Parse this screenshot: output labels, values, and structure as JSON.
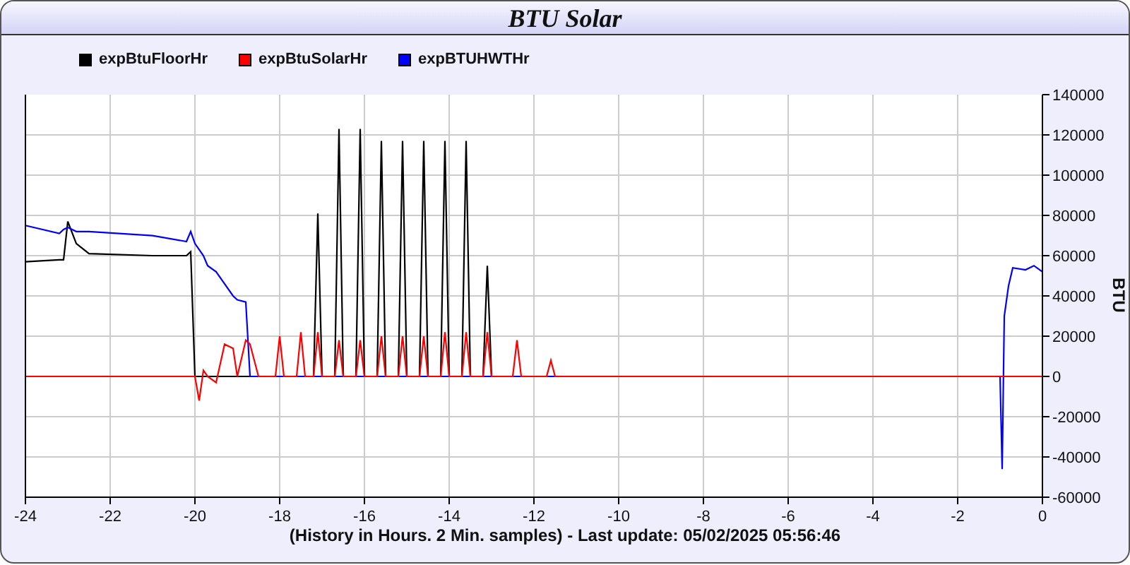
{
  "chart": {
    "chart_data": {
      "type": "line",
      "grid": true,
      "title": "BTU Solar",
      "xlabel": "(History in Hours. 2 Min. samples) - Last update: 05/02/2025 05:56:46",
      "ylabel": "BTU",
      "xlim": [
        -24,
        0
      ],
      "ylim": [
        -60000,
        140000
      ],
      "xticks": [
        -24,
        -22,
        -20,
        -18,
        -16,
        -14,
        -12,
        -10,
        -8,
        -6,
        -4,
        -2,
        0
      ],
      "yticks": [
        -60000,
        -40000,
        -20000,
        0,
        20000,
        40000,
        60000,
        80000,
        100000,
        120000,
        140000
      ],
      "x": [
        -24,
        -23.2,
        -23.1,
        -23,
        -22.8,
        -22.5,
        -21,
        -20.2,
        -20.1,
        -20,
        -19.9,
        -19.8,
        -19.7,
        -19.5,
        -19.3,
        -19.1,
        -19.0,
        -18.8,
        -18.7,
        -18.5,
        -18.1,
        -18.0,
        -17.9,
        -17.6,
        -17.5,
        -17.4,
        -17.2,
        -17.1,
        -17.0,
        -16.7,
        -16.6,
        -16.5,
        -16.2,
        -16.1,
        -16.0,
        -15.7,
        -15.6,
        -15.5,
        -15.2,
        -15.1,
        -15.0,
        -14.7,
        -14.6,
        -14.5,
        -14.2,
        -14.1,
        -14.0,
        -13.7,
        -13.6,
        -13.5,
        -13.2,
        -13.1,
        -13.0,
        -12.5,
        -12.4,
        -12.3,
        -11.7,
        -11.6,
        -11.5,
        -1.0,
        -0.95,
        -0.9,
        -0.8,
        -0.7,
        -0.4,
        -0.2,
        0
      ],
      "series": [
        {
          "name": "expBtuFloorHr",
          "color": "#000000",
          "values": [
            57000,
            58000,
            58000,
            77000,
            66000,
            61000,
            60000,
            60000,
            62000,
            0,
            0,
            0,
            0,
            0,
            0,
            0,
            0,
            0,
            0,
            0,
            0,
            0,
            0,
            0,
            0,
            0,
            0,
            81000,
            0,
            0,
            123000,
            0,
            0,
            123000,
            0,
            0,
            117000,
            0,
            0,
            117000,
            0,
            0,
            117000,
            0,
            0,
            117000,
            0,
            0,
            117000,
            0,
            0,
            55000,
            0,
            0,
            0,
            0,
            0,
            0,
            0,
            0,
            0,
            0,
            0,
            0,
            0,
            0,
            0
          ]
        },
        {
          "name": "expBtuSolarHr",
          "color": "#ff0000",
          "values": [
            0,
            0,
            0,
            0,
            0,
            0,
            0,
            0,
            0,
            0,
            -12000,
            3000,
            0,
            -3000,
            16000,
            14000,
            0,
            18000,
            16000,
            0,
            0,
            20000,
            0,
            0,
            22000,
            0,
            0,
            22000,
            0,
            0,
            18000,
            0,
            0,
            18000,
            0,
            0,
            20000,
            0,
            0,
            20000,
            0,
            0,
            20000,
            0,
            0,
            22000,
            0,
            0,
            22000,
            0,
            0,
            22000,
            0,
            0,
            18000,
            0,
            0,
            8000,
            0,
            0,
            0,
            0,
            0,
            0,
            0,
            0,
            0
          ]
        },
        {
          "name": "expBTUHWTHr",
          "color": "#0000ff",
          "values": [
            75000,
            71000,
            73000,
            74000,
            72000,
            72000,
            70000,
            67000,
            72000,
            66000,
            63000,
            60000,
            55000,
            52000,
            46000,
            40000,
            38000,
            37000,
            0,
            0,
            0,
            0,
            0,
            0,
            0,
            0,
            0,
            0,
            0,
            0,
            0,
            0,
            0,
            0,
            0,
            0,
            0,
            0,
            0,
            0,
            0,
            0,
            0,
            0,
            0,
            0,
            0,
            0,
            0,
            0,
            0,
            0,
            0,
            0,
            0,
            0,
            0,
            0,
            0,
            0,
            -46000,
            30000,
            45000,
            54000,
            53000,
            55000,
            52000
          ]
        }
      ]
    }
  }
}
